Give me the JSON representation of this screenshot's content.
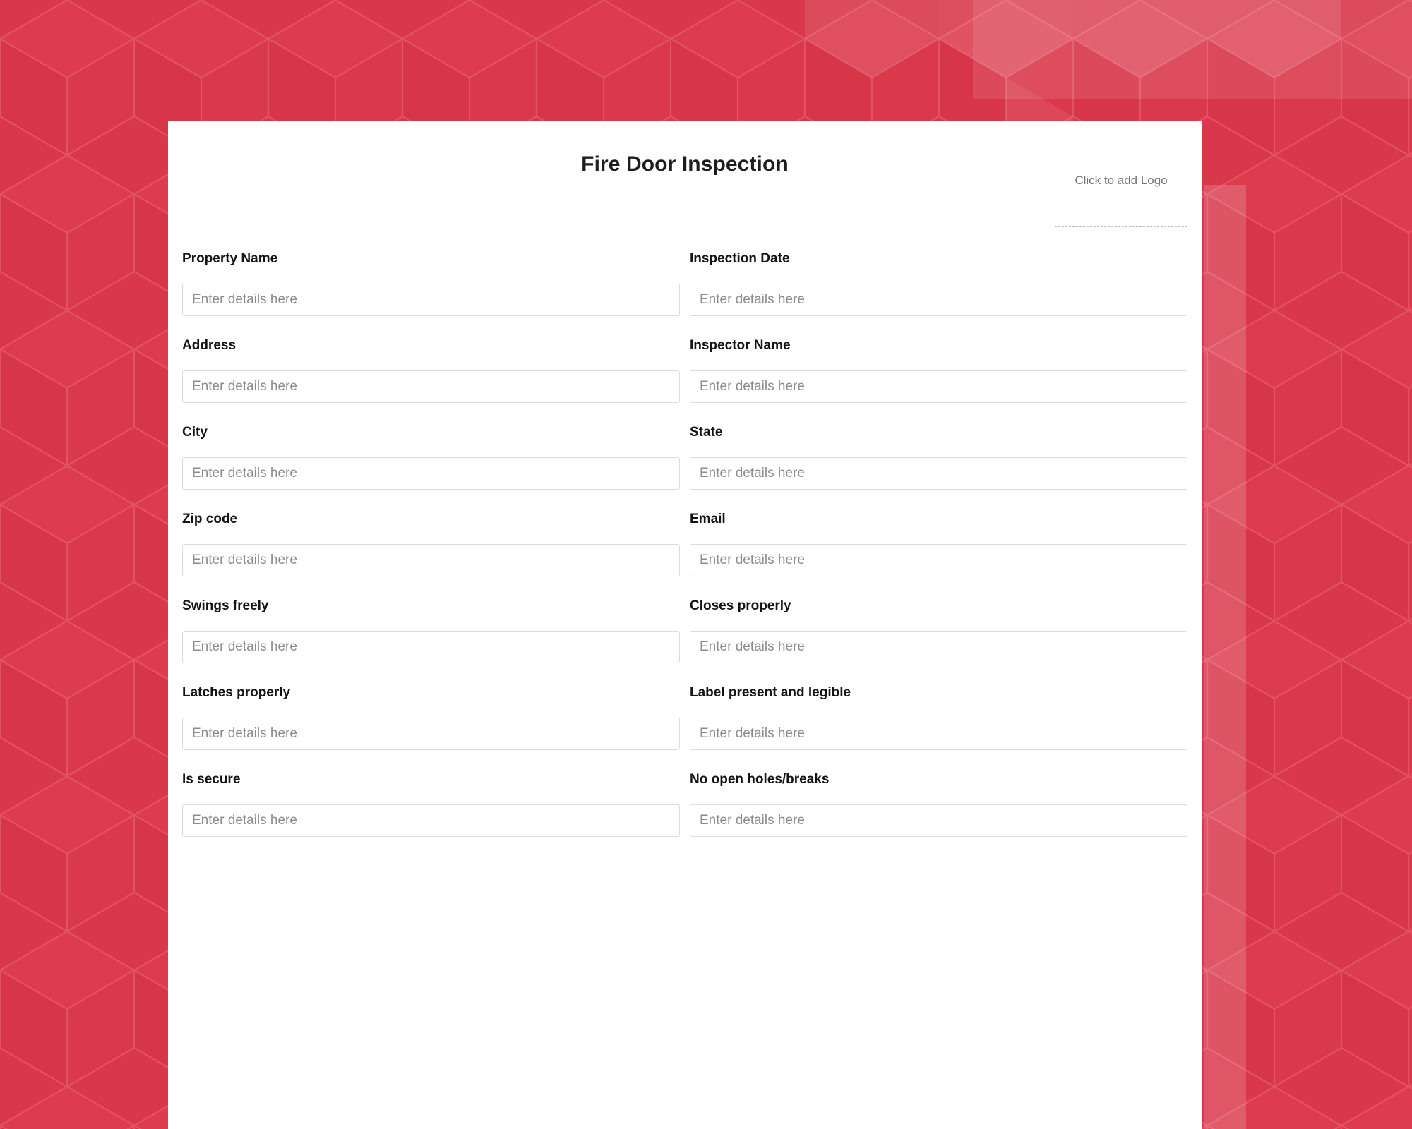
{
  "theme": {
    "background_color": "#d9374a",
    "background_pattern": "isometric-cubes",
    "card_background": "#ffffff",
    "label_color": "#141414",
    "placeholder_color": "#8c8c8c",
    "input_border_color": "#dcdcdc",
    "logo_border_color": "#b9b9b9"
  },
  "header": {
    "title": "Fire Door Inspection",
    "logo_placeholder_label": "Click to add Logo"
  },
  "form": {
    "placeholder": "Enter details here",
    "fields": [
      {
        "label": "Property Name",
        "value": "",
        "name": "property-name"
      },
      {
        "label": "Inspection Date",
        "value": "",
        "name": "inspection-date"
      },
      {
        "label": "Address",
        "value": "",
        "name": "address"
      },
      {
        "label": "Inspector Name",
        "value": "",
        "name": "inspector-name"
      },
      {
        "label": "City",
        "value": "",
        "name": "city"
      },
      {
        "label": "State",
        "value": "",
        "name": "state"
      },
      {
        "label": "Zip code",
        "value": "",
        "name": "zip-code"
      },
      {
        "label": "Email",
        "value": "",
        "name": "email"
      },
      {
        "label": "Swings freely",
        "value": "",
        "name": "swings-freely"
      },
      {
        "label": "Closes properly",
        "value": "",
        "name": "closes-properly"
      },
      {
        "label": "Latches properly",
        "value": "",
        "name": "latches-properly"
      },
      {
        "label": "Label present and legible",
        "value": "",
        "name": "label-present-and-legible"
      },
      {
        "label": "Is secure",
        "value": "",
        "name": "is-secure"
      },
      {
        "label": "No open holes/breaks",
        "value": "",
        "name": "no-open-holes-breaks"
      }
    ]
  }
}
